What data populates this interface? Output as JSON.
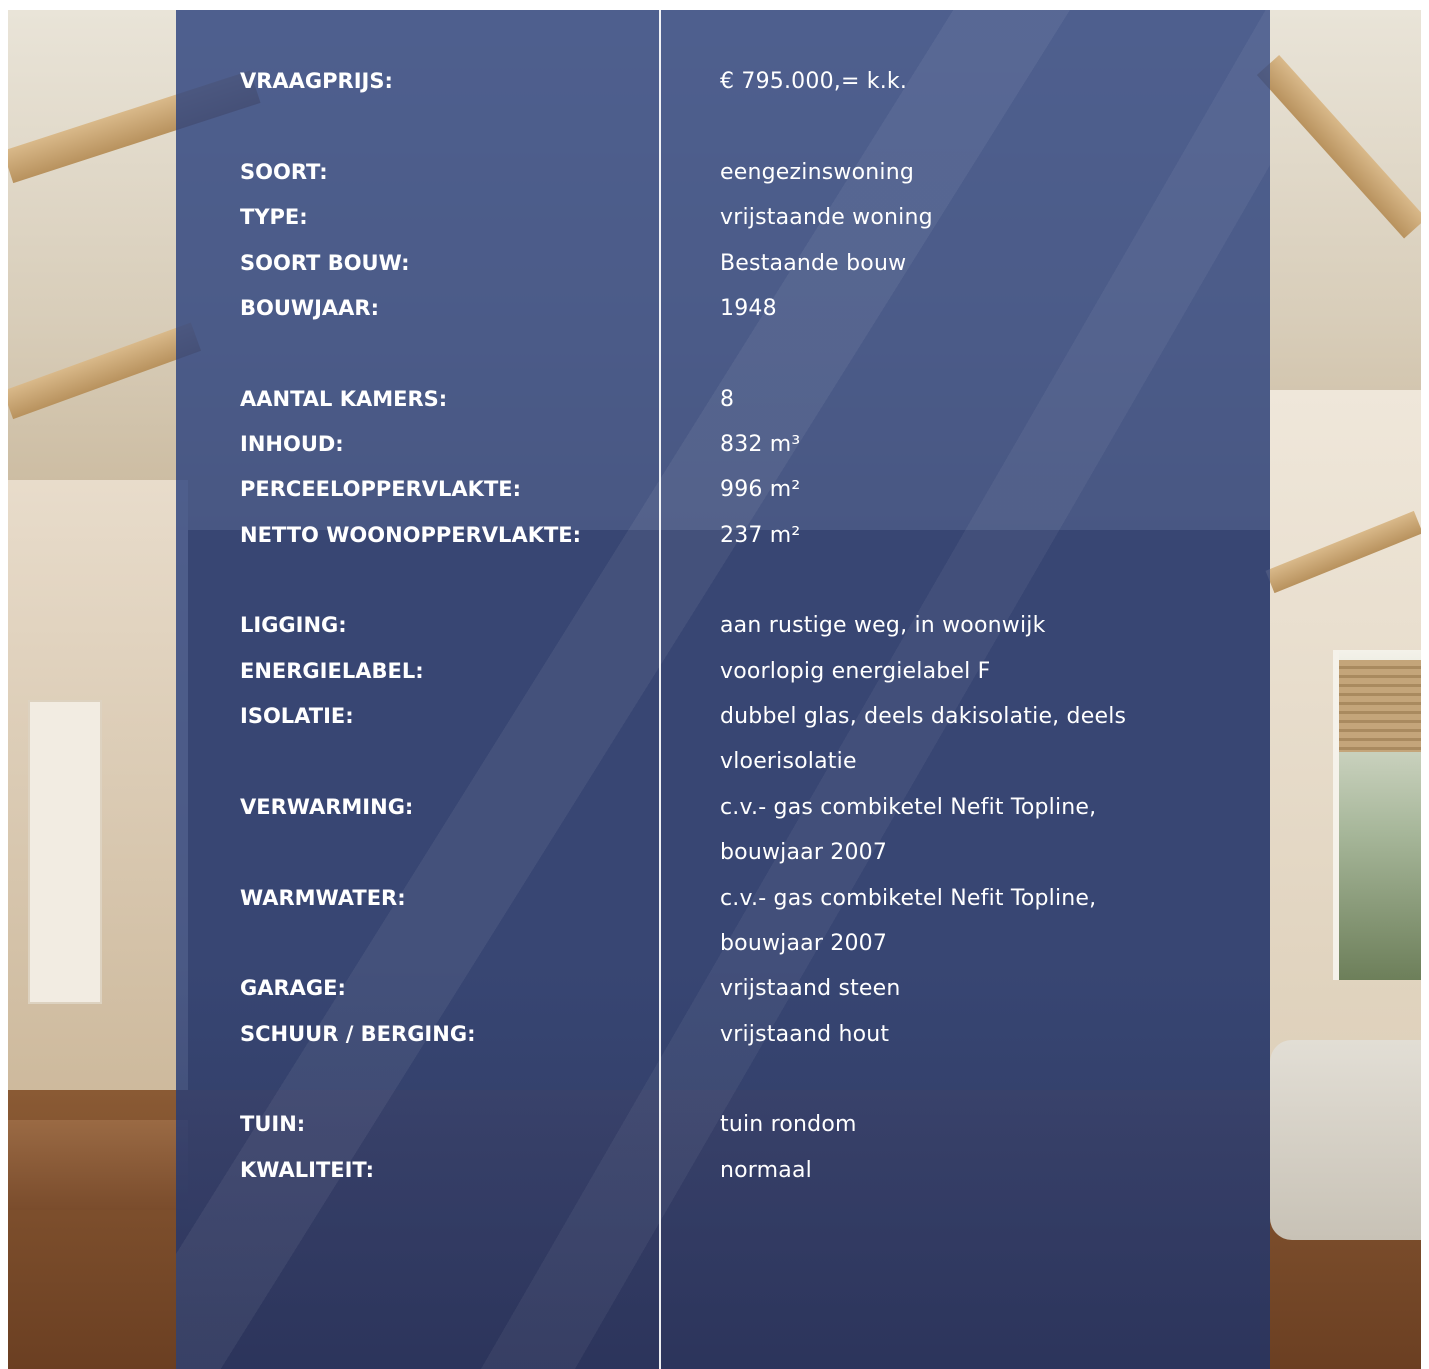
{
  "spec_sheet": {
    "rows": [
      {
        "label": "VRAAGPRIJS:",
        "value": "€  795.000,= k.k."
      },
      {
        "label": "SOORT:",
        "value": "eengezinswoning"
      },
      {
        "label": "TYPE:",
        "value": "vrijstaande woning"
      },
      {
        "label": "SOORT BOUW:",
        "value": "Bestaande bouw"
      },
      {
        "label": "BOUWJAAR:",
        "value": "1948"
      },
      {
        "label": "AANTAL KAMERS:",
        "value": "8"
      },
      {
        "label": "INHOUD:",
        "value": "832 m³"
      },
      {
        "label": "PERCEELOPPERVLAKTE:",
        "value": "996 m²"
      },
      {
        "label": "NETTO WOONOPPERVLAKTE:",
        "value": "237 m²"
      },
      {
        "label": "LIGGING:",
        "value": "aan rustige weg, in woonwijk"
      },
      {
        "label": "ENERGIELABEL:",
        "value": "voorlopig energielabel F"
      },
      {
        "label": "ISOLATIE:",
        "value": "dubbel glas, deels dakisolatie, deels vloerisolatie"
      },
      {
        "label": "VERWARMING:",
        "value": "c.v.- gas combiketel Nefit Topline, bouwjaar 2007"
      },
      {
        "label": "WARMWATER:",
        "value": "c.v.- gas combiketel Nefit Topline, bouwjaar 2007"
      },
      {
        "label": "GARAGE:",
        "value": "vrijstaand steen"
      },
      {
        "label": "SCHUUR / BERGING:",
        "value": "vrijstaand hout"
      },
      {
        "label": "TUIN:",
        "value": "tuin rondom"
      },
      {
        "label": "KWALITEIT:",
        "value": "normaal"
      }
    ]
  },
  "colors": {
    "overlay": "#2c427e",
    "text": "#ffffff",
    "divider": "#ffffff"
  }
}
